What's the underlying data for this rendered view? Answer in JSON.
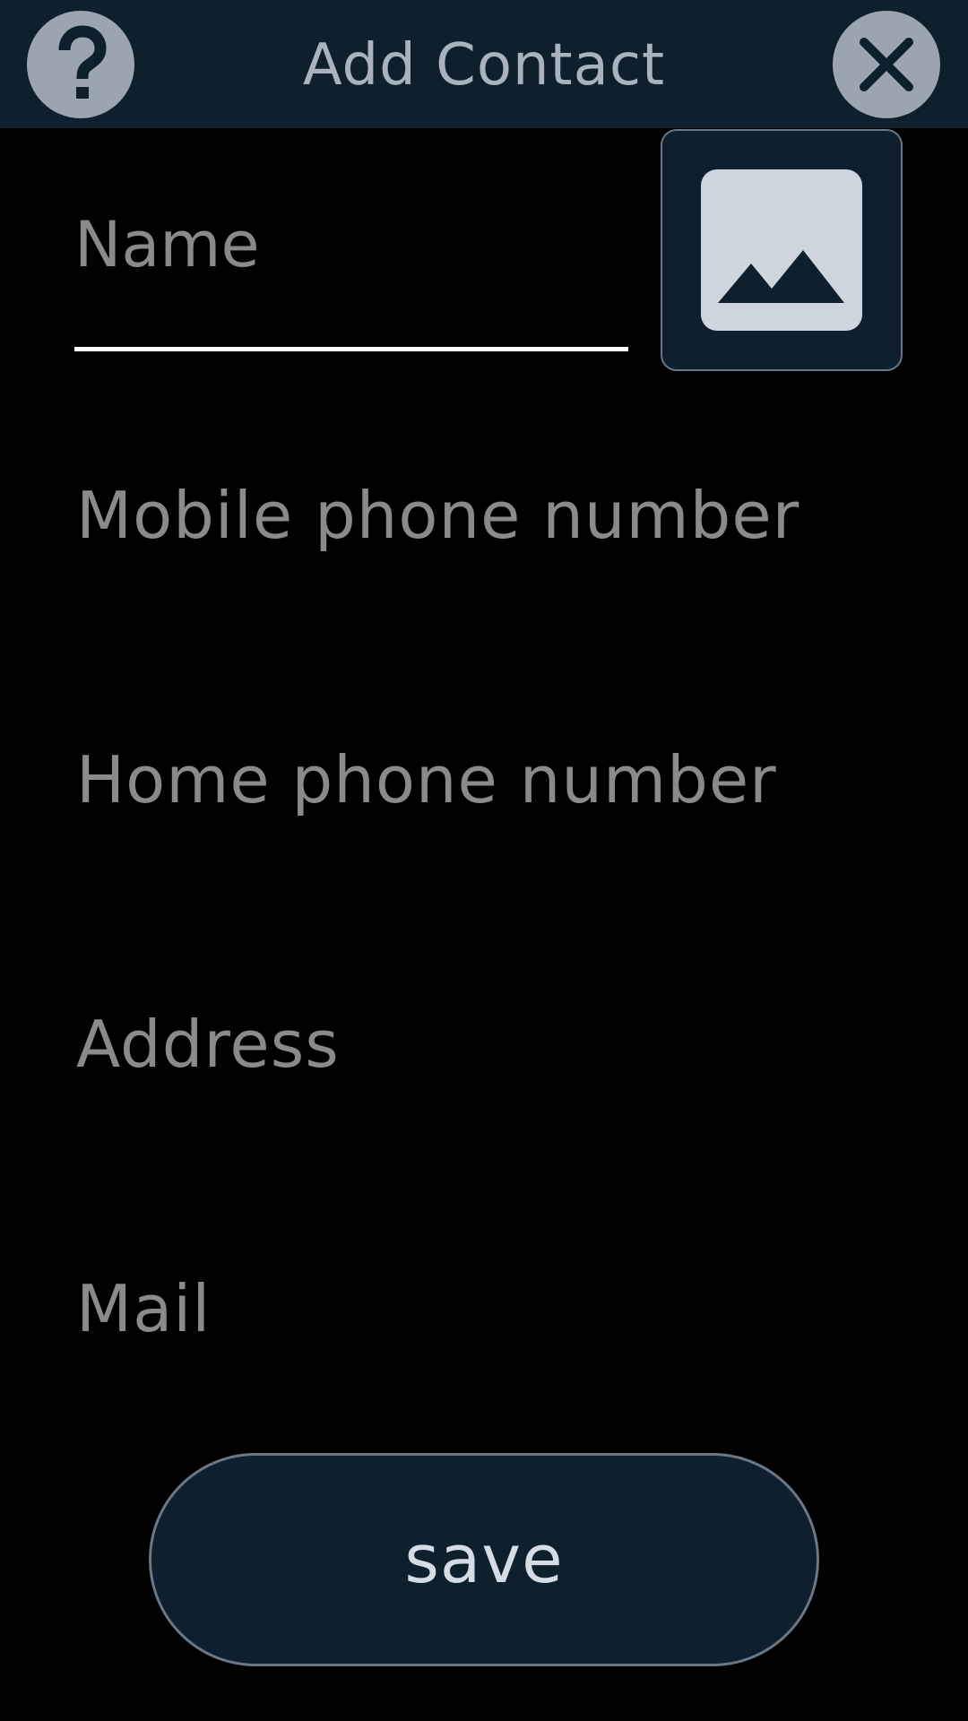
{
  "header": {
    "title": "Add Contact",
    "help_icon": "question-mark-icon",
    "close_icon": "close-x-icon"
  },
  "form": {
    "name_placeholder": "Name",
    "name_value": "",
    "photo_icon": "image-placeholder-icon",
    "mobile_placeholder": "Mobile phone number",
    "home_placeholder": "Home phone number",
    "address_placeholder": "Address",
    "mail_placeholder": "Mail"
  },
  "actions": {
    "save_label": "save"
  },
  "colors": {
    "background": "#000000",
    "header_bg": "#0e1f2e",
    "round_button_bg": "#9aa5af",
    "placeholder_text": "#8a8a8a",
    "underline": "#ffffff",
    "button_text": "#d4dde6",
    "button_border": "#6b7784"
  }
}
